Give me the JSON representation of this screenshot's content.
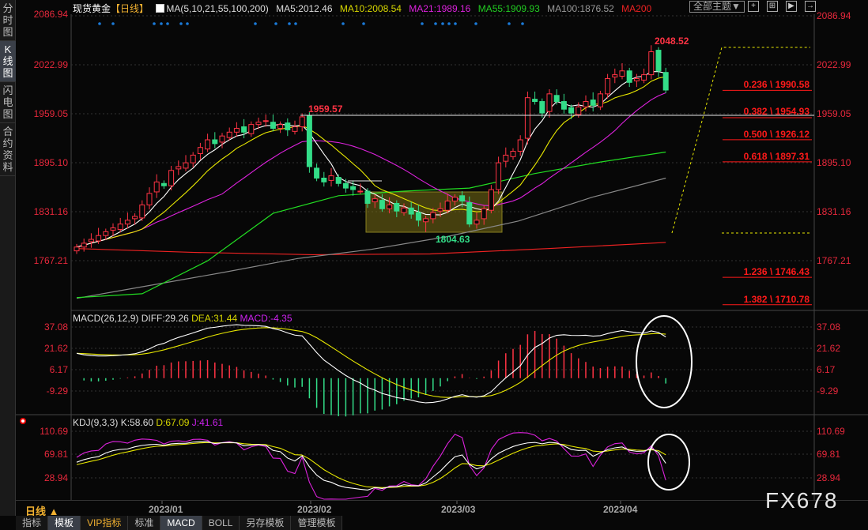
{
  "sidebar": {
    "tabs": [
      "分时图",
      "K线图",
      "闪电图",
      "合约资料"
    ],
    "active": 1
  },
  "header": {
    "symbol": "现货黄金",
    "period": "【日线】",
    "ma_label": "MA(5,10,21,55,100,200)",
    "ma5": "MA5:2012.46",
    "ma10": "MA10:2008.54",
    "ma21": "MA21:1989.16",
    "ma55": "MA55:1909.93",
    "ma100": "MA100:1876.52",
    "ma200": "MA200",
    "theme_button": "全部主题▼"
  },
  "colors": {
    "up": "#ff3344",
    "down": "#33dd88",
    "ma5": "#ffffff",
    "ma10": "#e8e800",
    "ma21": "#dd22dd",
    "ma55": "#22dd22",
    "ma100": "#888888",
    "ma200": "#ee2222"
  },
  "price_axis": {
    "ticks": [
      "2086.94",
      "2022.99",
      "1959.05",
      "1895.10",
      "1831.16",
      "1767.21"
    ],
    "range": [
      1767.21,
      2086.94
    ]
  },
  "annotations": {
    "high": "2048.52",
    "peak": "1959.57",
    "low": "1804.63"
  },
  "fib": [
    "0.236 \\ 1990.58",
    "0.382 \\ 1954.93",
    "0.500 \\ 1926.12",
    "0.618 \\ 1897.31",
    "1.236 \\ 1746.43",
    "1.382 \\ 1710.78"
  ],
  "fib_prices": [
    1990.58,
    1954.93,
    1926.12,
    1897.31,
    1746.43,
    1710.78
  ],
  "closes": [
    1785,
    1790,
    1795,
    1800,
    1805,
    1810,
    1815,
    1820,
    1825,
    1840,
    1855,
    1870,
    1865,
    1885,
    1890,
    1895,
    1905,
    1915,
    1925,
    1920,
    1930,
    1935,
    1940,
    1935,
    1945,
    1948,
    1950,
    1940,
    1945,
    1938,
    1942,
    1955,
    1890,
    1875,
    1870,
    1878,
    1868,
    1862,
    1860,
    1858,
    1842,
    1848,
    1835,
    1840,
    1832,
    1836,
    1828,
    1820,
    1822,
    1830,
    1835,
    1845,
    1850,
    1845,
    1815,
    1820,
    1835,
    1860,
    1895,
    1905,
    1910,
    1925,
    1980,
    1975,
    1960,
    1985,
    1975,
    1965,
    1960,
    1968,
    1975,
    1970,
    1985,
    2005,
    2010,
    2015,
    2000,
    2005,
    2010,
    2040,
    2015,
    1990
  ],
  "ma55_line": [
    1719,
    1724,
    1767,
    1829,
    1852,
    1858,
    1862,
    1881,
    1896,
    1909
  ],
  "ma100_line": [
    1718,
    1735,
    1752,
    1770,
    1782,
    1798,
    1819,
    1850,
    1875
  ],
  "ma200_line": [
    1783,
    1778,
    1775,
    1776,
    1783,
    1791
  ],
  "macd": {
    "label": "MACD(26,12,9)",
    "diff": "DIFF:29.26",
    "dea": "DEA:31.44",
    "macd": "MACD:-4.35",
    "ticks": [
      "37.08",
      "21.62",
      "6.17",
      "-9.29"
    ],
    "range": [
      -9.29,
      37.08
    ]
  },
  "kdj": {
    "label": "KDJ(9,3,3)",
    "k": "K:58.60",
    "d": "D:67.09",
    "j": "J:41.61",
    "ticks": [
      "110.69",
      "69.81",
      "28.94"
    ],
    "range": [
      28.94,
      110.69
    ]
  },
  "dates": [
    "2023/01",
    "2023/02",
    "2023/03",
    "2023/04"
  ],
  "period_button": "日线 ▲",
  "bottom_tabs": [
    "指标",
    "模板",
    "VIP指标",
    "标准",
    "MACD",
    "BOLL",
    "另存模板",
    "管理模板"
  ],
  "watermark": "FX678"
}
